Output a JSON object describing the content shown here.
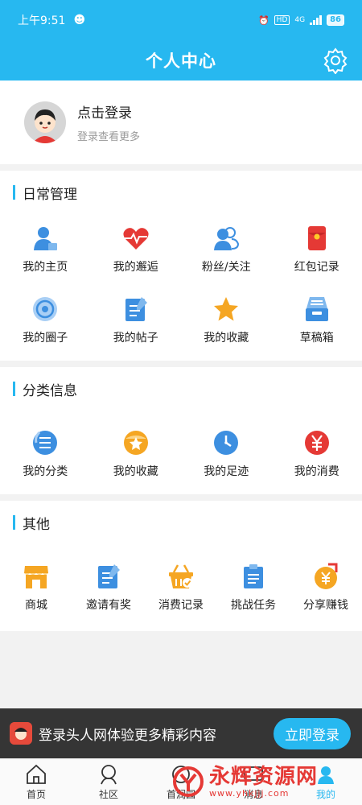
{
  "status_bar": {
    "time": "上午9:51",
    "network": "4G",
    "hd": "HD",
    "battery": "86"
  },
  "header": {
    "title": "个人中心"
  },
  "profile": {
    "login_title": "点击登录",
    "login_subtitle": "登录查看更多"
  },
  "sections": [
    {
      "title": "日常管理",
      "items": [
        {
          "label": "我的主页",
          "icon": "user-home-icon",
          "color": "#3d8fe0"
        },
        {
          "label": "我的邂逅",
          "icon": "heartbeat-icon",
          "color": "#e53935"
        },
        {
          "label": "粉丝/关注",
          "icon": "fans-icon",
          "color": "#3d8fe0"
        },
        {
          "label": "红包记录",
          "icon": "red-envelope-icon",
          "color": "#e53935"
        },
        {
          "label": "我的圈子",
          "icon": "circle-icon",
          "color": "#3d8fe0"
        },
        {
          "label": "我的帖子",
          "icon": "post-icon",
          "color": "#3d8fe0"
        },
        {
          "label": "我的收藏",
          "icon": "star-icon",
          "color": "#f5a623"
        },
        {
          "label": "草稿箱",
          "icon": "drafts-icon",
          "color": "#3d8fe0"
        }
      ]
    },
    {
      "title": "分类信息",
      "items": [
        {
          "label": "我的分类",
          "icon": "category-icon",
          "color": "#3d8fe0"
        },
        {
          "label": "我的收藏",
          "icon": "favorite-icon",
          "color": "#f5a623"
        },
        {
          "label": "我的足迹",
          "icon": "footprint-clock-icon",
          "color": "#3d8fe0"
        },
        {
          "label": "我的消费",
          "icon": "yuan-icon",
          "color": "#e53935"
        }
      ]
    },
    {
      "title": "其他",
      "items": [
        {
          "label": "商城",
          "icon": "shop-icon",
          "color": "#f5a623"
        },
        {
          "label": "邀请有奖",
          "icon": "invite-icon",
          "color": "#3d8fe0"
        },
        {
          "label": "消费记录",
          "icon": "basket-icon",
          "color": "#f5a623"
        },
        {
          "label": "挑战任务",
          "icon": "clipboard-icon",
          "color": "#3d8fe0"
        },
        {
          "label": "分享赚钱",
          "icon": "share-money-icon",
          "color": "#f5a623"
        }
      ]
    }
  ],
  "banner": {
    "text": "登录头人网体验更多精彩内容",
    "button": "立即登录"
  },
  "tabs": [
    {
      "label": "首页",
      "icon": "home-icon"
    },
    {
      "label": "社区",
      "icon": "community-icon"
    },
    {
      "label": "首润园",
      "icon": "garden-icon"
    },
    {
      "label": "消息",
      "icon": "message-icon"
    },
    {
      "label": "我的",
      "icon": "mine-icon"
    }
  ],
  "watermark": {
    "text": "永辉资源网",
    "url": "www.yhkjjj.com"
  },
  "colors": {
    "primary": "#27b8f0",
    "red": "#e53935",
    "orange": "#f5a623",
    "blue": "#3d8fe0"
  }
}
